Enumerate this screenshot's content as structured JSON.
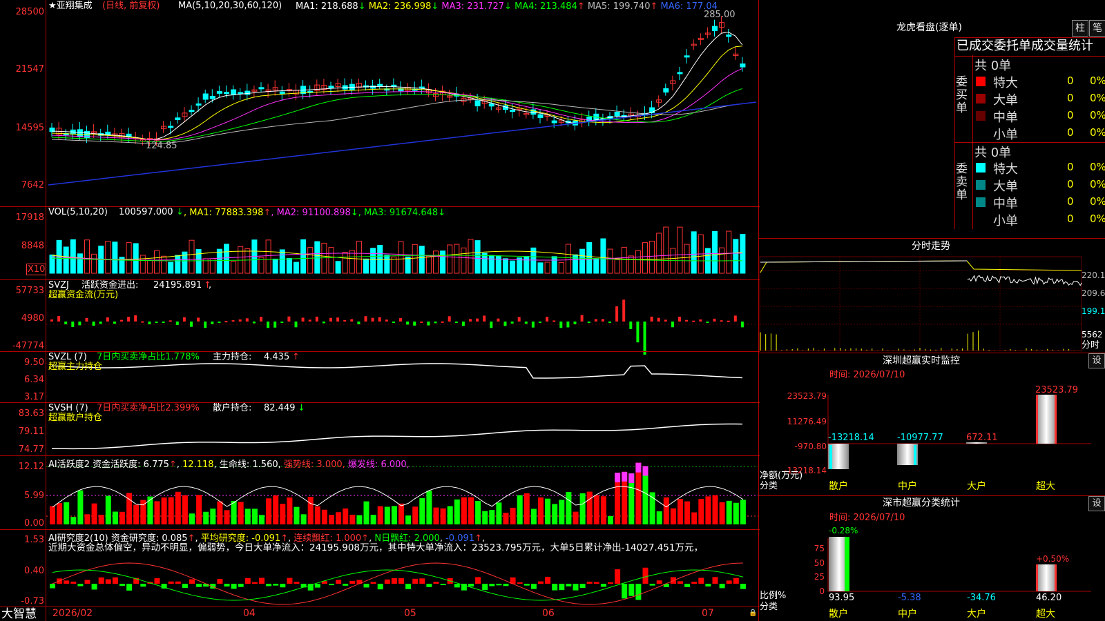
{
  "main": {
    "title": "★亚翔集成",
    "title_mode": "(日线, 前复权)",
    "ma_params": "MA(5,10,20,30,60,120)",
    "ma": [
      {
        "label": "MA1:",
        "value": "218.688",
        "arrow": "↓",
        "color": "#ffffff"
      },
      {
        "label": "MA2:",
        "value": "236.998",
        "arrow": "↓",
        "color": "#ffff00"
      },
      {
        "label": "MA3:",
        "value": "231.727",
        "arrow": "↓",
        "color": "#ff33ff"
      },
      {
        "label": "MA4:",
        "value": "213.484",
        "arrow": "↑",
        "color": "#00ff00"
      },
      {
        "label": "MA5:",
        "value": "199.740",
        "arrow": "↑",
        "color": "#bbbbbb"
      },
      {
        "label": "MA6:",
        "value": "177.04",
        "arrow": "",
        "color": "#3366ff"
      }
    ],
    "y_ticks": [
      "28500",
      "21547",
      "14595",
      "7642"
    ],
    "high_label": "285.00",
    "low_label": "124.85",
    "x_ticks": [
      "2026/02",
      "04",
      "05",
      "06",
      "07"
    ]
  },
  "vol": {
    "header": "VOL(5,10,20)",
    "value": "100597.000",
    "value_arrow": "↓",
    "ma": [
      {
        "label": "MA1:",
        "value": "77883.398",
        "arrow": "↑"
      },
      {
        "label": "MA2:",
        "value": "91100.898",
        "arrow": "↓"
      },
      {
        "label": "MA3:",
        "value": "91674.648",
        "arrow": "↓"
      }
    ],
    "y_ticks": [
      "17918",
      "8848"
    ],
    "unit": "X10"
  },
  "svzj": {
    "line1_name": "SVZJ",
    "line1_label": "活跃资金进出:",
    "line1_value": "24195.891",
    "line1_arrow": "↑",
    "line2": "超赢资金流(万元)",
    "y_ticks": [
      "57733",
      "4980",
      "-47774"
    ]
  },
  "svzl": {
    "name": "SVZL (7)",
    "ratio_label": "7日内买卖净占比1.778%",
    "hold_label": "主力持仓:",
    "hold_value": "4.435",
    "hold_arrow": "↑",
    "line2": "超赢主力持仓",
    "y_ticks": [
      "9.50",
      "6.34",
      "3.17"
    ]
  },
  "svsh": {
    "name": "SVSH (7)",
    "ratio_label": "7日内买卖净占比2.399%",
    "hold_label": "散户持仓:",
    "hold_value": "82.449",
    "hold_arrow": "↓",
    "line2": "超赢散户持仓",
    "y_ticks": [
      "83.63",
      "79.11",
      "74.77"
    ]
  },
  "ai_active": {
    "header": "AI活跃度2",
    "fund_label": "资金活跃度:",
    "fund_value": "6.775",
    "v2": "12.118",
    "life_label": "生命线:",
    "life_value": "1.560",
    "strong_label": "强势线:",
    "strong_value": "3.000",
    "burst_label": "爆发线:",
    "burst_value": "6.000",
    "y_ticks": [
      "12.12",
      "5.99",
      "0.00"
    ]
  },
  "ai_research": {
    "header": "AI研究度2(10)",
    "fund_label": "资金研究度:",
    "fund_value": "0.085",
    "avg_label": "平均研究度:",
    "avg_value": "-0.091",
    "red_label": "连续飘红:",
    "red_value": "1.000",
    "n_label": "N日飘红:",
    "n_value": "2.000",
    "last_value": "-0.091",
    "summary": "近期大资金总体偏空，异动不明显，偏弱势，今日大单净流入：24195.908万元，其中特大单净流入：23523.795万元，大单5日累计净出-14027.451万元，",
    "y_ticks": [
      "1.53",
      "0.40",
      "-0.73"
    ]
  },
  "logo": "大智慧",
  "right": {
    "lhb_title": "龙虎看盘(逐单)",
    "btn_bar": "柱",
    "btn_pen": "笔",
    "tabs_line": "已成交委托单成交量统计",
    "buy_label": "委买单",
    "sell_label": "委卖单",
    "buy_total": "共 0单",
    "sell_total": "共 0单",
    "buy_rows": [
      {
        "name": "特大",
        "count": "0",
        "pct": "0%",
        "color": "#ff0000"
      },
      {
        "name": "大单",
        "count": "0",
        "pct": "0%",
        "color": "#990000"
      },
      {
        "name": "中单",
        "count": "0",
        "pct": "0%",
        "color": "#660000"
      },
      {
        "name": "小单",
        "count": "0",
        "pct": "0%",
        "color": ""
      }
    ],
    "sell_rows": [
      {
        "name": "特大",
        "count": "0",
        "pct": "0%",
        "color": "#00ffff"
      },
      {
        "name": "大单",
        "count": "0",
        "pct": "0%",
        "color": "#008888"
      },
      {
        "name": "中单",
        "count": "0",
        "pct": "0%",
        "color": "#008888"
      },
      {
        "name": "小单",
        "count": "0",
        "pct": "0%",
        "color": ""
      }
    ],
    "fs_title": "分时走势",
    "fs_y": [
      "220.1",
      "209.6",
      "199.1",
      "5562"
    ],
    "fs_label": "分时",
    "monitor_title": "深圳超赢实时监控",
    "monitor_time": "时间: 2026/07/10",
    "monitor_btn": "设",
    "monitor_y": [
      "23523.79",
      "11276.49",
      "-970.80",
      "-13218.14"
    ],
    "monitor_unit": "净额(万元)",
    "monitor_cat": "分类",
    "monitor_bars": [
      {
        "cat": "散户",
        "value": "-13218.14"
      },
      {
        "cat": "中户",
        "value": "-10977.77"
      },
      {
        "cat": "大户",
        "value": "672.11"
      },
      {
        "cat": "超大",
        "value": "23523.79"
      }
    ],
    "stat_title": "深市超赢分类统计",
    "stat_time": "时间: 2026/07/10",
    "stat_btn": "设",
    "stat_y": [
      "75",
      "50",
      "25",
      "0"
    ],
    "stat_unit": "比例%",
    "stat_cat": "分类",
    "stat_top": [
      "-0.28%",
      "+0.50%"
    ],
    "stat_bars": [
      {
        "cat": "散户",
        "value": "93.95"
      },
      {
        "cat": "中户",
        "value": "-5.38"
      },
      {
        "cat": "大户",
        "value": "-34.76"
      },
      {
        "cat": "超大",
        "value": "46.20"
      }
    ]
  }
}
